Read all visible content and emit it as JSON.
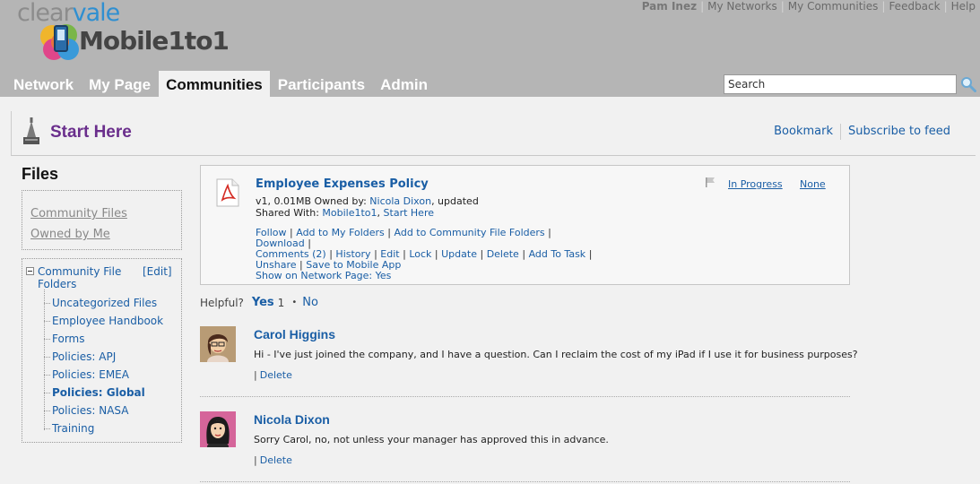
{
  "header": {
    "logo_clear_a": "clear",
    "logo_clear_b": "vale",
    "brand": "Mobile1to1",
    "user": "Pam Inez",
    "links": [
      "My Networks",
      "My Communities",
      "Feedback",
      "Help"
    ]
  },
  "nav": {
    "tabs": [
      {
        "label": "Network"
      },
      {
        "label": "My Page"
      },
      {
        "label": "Communities",
        "active": true
      },
      {
        "label": "Participants"
      },
      {
        "label": "Admin"
      }
    ]
  },
  "search": {
    "value": "Search"
  },
  "page": {
    "title": "Start Here",
    "bookmark": "Bookmark",
    "subscribe": "Subscribe to feed"
  },
  "sidebar": {
    "heading": "Files",
    "filters": [
      "Community Files",
      "Owned by Me"
    ],
    "root": "Community File Folders",
    "edit": "[Edit]",
    "folders": [
      {
        "label": "Uncategorized Files"
      },
      {
        "label": "Employee Handbook"
      },
      {
        "label": "Forms"
      },
      {
        "label": "Policies: APJ"
      },
      {
        "label": "Policies: EMEA"
      },
      {
        "label": "Policies: Global",
        "selected": true
      },
      {
        "label": "Policies: NASA"
      },
      {
        "label": "Training"
      }
    ]
  },
  "file": {
    "title": "Employee Expenses Policy",
    "meta_prefix": "v1, 0.01MB Owned by: ",
    "owner": "Nicola Dixon",
    "meta_suffix": ", updated",
    "shared_prefix": "Shared With: ",
    "shared": [
      "Mobile1to1",
      "Start Here"
    ],
    "status": "In Progress",
    "none": "None",
    "actions": [
      "Follow",
      "Add to My Folders",
      "Add to Community File Folders",
      "Download",
      "Comments (2)",
      "History",
      "Edit",
      "Lock",
      "Update",
      "Delete",
      "Add To Task",
      "Unshare",
      "Save to Mobile App",
      "Show on Network Page: Yes"
    ]
  },
  "helpful": {
    "label": "Helpful?",
    "yes": "Yes",
    "yes_count": "1",
    "dot": "•",
    "no": "No"
  },
  "comments": [
    {
      "author": "Carol Higgins",
      "text": "Hi - I've just joined the company, and I have a question. Can I reclaim the cost of my iPad if I use it for business purposes?",
      "pipe": "|",
      "delete": "Delete"
    },
    {
      "author": "Nicola Dixon",
      "text": "Sorry Carol, no, not unless your manager has approved this in advance.",
      "pipe": "|",
      "delete": "Delete"
    }
  ],
  "colors": {
    "header_bg": "#b5b5b5",
    "link": "#1a5ea5",
    "title": "#6a2e8c"
  }
}
